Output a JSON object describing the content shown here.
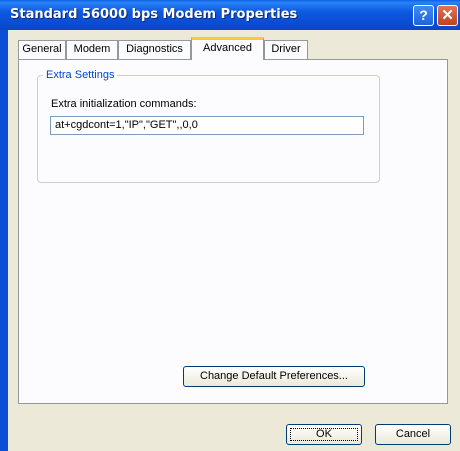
{
  "window": {
    "title": "Standard 56000 bps Modem Properties",
    "help_glyph": "?",
    "close_glyph": "✕"
  },
  "tabs": [
    {
      "label": "General",
      "active": false
    },
    {
      "label": "Modem",
      "active": false
    },
    {
      "label": "Diagnostics",
      "active": false
    },
    {
      "label": "Advanced",
      "active": true
    },
    {
      "label": "Driver",
      "active": false
    }
  ],
  "extra_settings": {
    "group_label": "Extra Settings",
    "field_label": "Extra initialization commands:",
    "field_value": "at+cgdcont=1,\"IP\",\"GET\",,0,0"
  },
  "buttons": {
    "change_defaults": "Change Default Preferences...",
    "ok": "OK",
    "cancel": "Cancel"
  },
  "colors": {
    "titlebar": "#0b4fd4",
    "group_label": "#0046d5",
    "active_tab_highlight": "#ffc83c"
  }
}
